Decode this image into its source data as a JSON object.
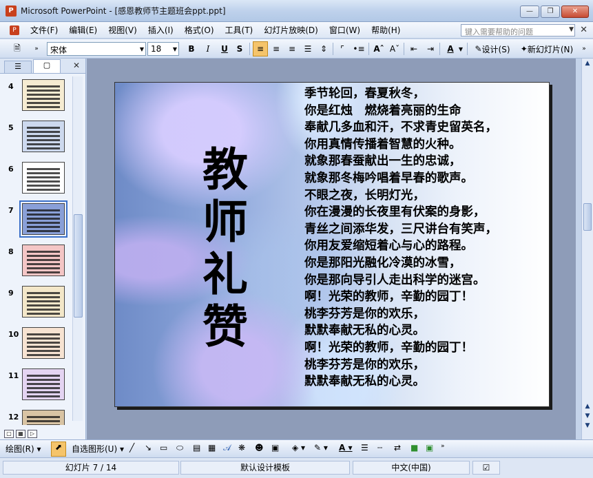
{
  "window": {
    "title": "Microsoft PowerPoint - [感恩教师节主题班会ppt.ppt]",
    "app_icon": "P"
  },
  "menubar": {
    "items": [
      "文件(F)",
      "编辑(E)",
      "视图(V)",
      "插入(I)",
      "格式(O)",
      "工具(T)",
      "幻灯片放映(D)",
      "窗口(W)",
      "帮助(H)"
    ],
    "help_placeholder": "键入需要帮助的问题"
  },
  "toolbar": {
    "font_name": "宋体",
    "font_size": "18",
    "bold": "B",
    "italic": "I",
    "underline": "U",
    "shadow": "S",
    "design_label": "设计(S)",
    "new_slide_label": "新幻灯片(N)"
  },
  "thumbnails": [
    {
      "num": "4",
      "color": "#f6ecd2"
    },
    {
      "num": "5",
      "color": "#cdd9ee"
    },
    {
      "num": "6",
      "color": "#ffffff"
    },
    {
      "num": "7",
      "color": "#8aa0d8",
      "selected": true
    },
    {
      "num": "8",
      "color": "#f4c6c6"
    },
    {
      "num": "9",
      "color": "#f3e7c9"
    },
    {
      "num": "10",
      "color": "#f7e3d2"
    },
    {
      "num": "11",
      "color": "#e4d4f2"
    },
    {
      "num": "12",
      "color": "#d9c4a4"
    }
  ],
  "slide": {
    "title_chars": [
      "教",
      "师",
      "礼",
      "赞"
    ],
    "poem_lines": [
      "季节轮回，春夏秋冬，",
      "你是红烛　燃烧着亮丽的生命",
      "奉献几多血和汗，不求青史留英名，",
      "你用真情传播着智慧的火种。",
      "就象那春蚕献出一生的忠诚，",
      "就象那冬梅吟唱着早春的歌声。",
      "不眼之夜，长明灯光，",
      "你在漫漫的长夜里有伏案的身影，",
      "青丝之间添华发，三尺讲台有笑声，",
      "你用友爱缩短着心与心的路程。",
      "你是那阳光融化冷漠的冰雪，",
      "你是那向导引人走出科学的迷宫。",
      "啊！光荣的教师，辛勤的园丁！",
      "桃李芬芳是你的欢乐，",
      "默默奉献无私的心灵。",
      "啊！光荣的教师，辛勤的园丁！",
      "桃李芬芳是你的欢乐，",
      "默默奉献无私的心灵。"
    ]
  },
  "drawbar": {
    "draw_label": "绘图(R)",
    "autoshape_label": "自选图形(U)"
  },
  "status": {
    "slide_info": "幻灯片 7 / 14",
    "template": "默认设计模板",
    "language": "中文(中国)"
  }
}
